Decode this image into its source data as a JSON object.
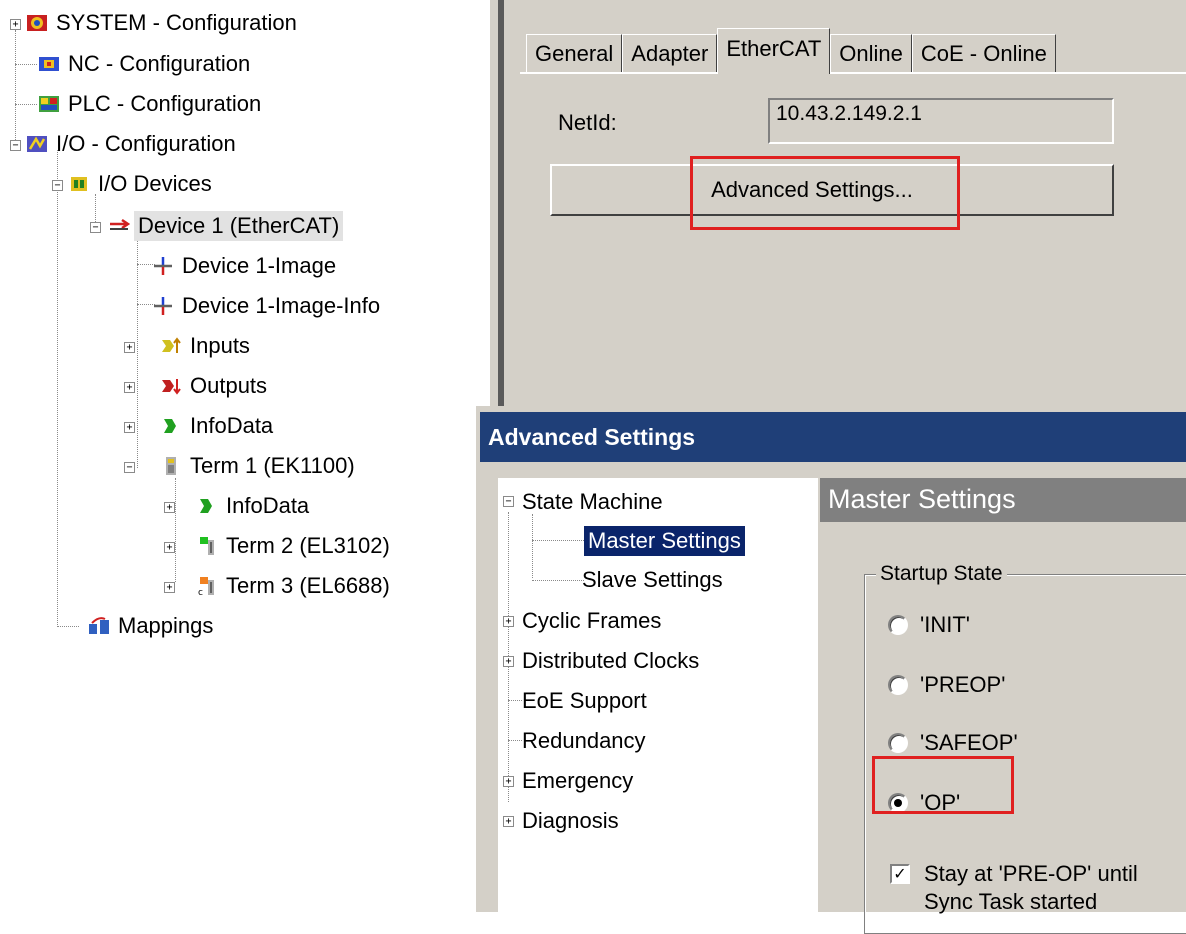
{
  "tree": {
    "items": [
      {
        "label": "SYSTEM - Configuration"
      },
      {
        "label": "NC - Configuration"
      },
      {
        "label": "PLC - Configuration"
      },
      {
        "label": "I/O - Configuration"
      },
      {
        "label": "I/O Devices"
      },
      {
        "label": "Device 1 (EtherCAT)"
      },
      {
        "label": "Device 1-Image"
      },
      {
        "label": "Device 1-Image-Info"
      },
      {
        "label": "Inputs"
      },
      {
        "label": "Outputs"
      },
      {
        "label": "InfoData"
      },
      {
        "label": "Term 1 (EK1100)"
      },
      {
        "label": "InfoData"
      },
      {
        "label": "Term 2 (EL3102)"
      },
      {
        "label": "Term 3 (EL6688)"
      },
      {
        "label": "Mappings"
      }
    ]
  },
  "tabs": [
    "General",
    "Adapter",
    "EtherCAT",
    "Online",
    "CoE - Online"
  ],
  "netid": {
    "label": "NetId:",
    "value": "10.43.2.149.2.1"
  },
  "advanced_button": "Advanced Settings...",
  "dialog": {
    "title": "Advanced Settings",
    "tree": [
      {
        "label": "State Machine"
      },
      {
        "label": "Master Settings"
      },
      {
        "label": "Slave Settings"
      },
      {
        "label": "Cyclic Frames"
      },
      {
        "label": "Distributed Clocks"
      },
      {
        "label": "EoE Support"
      },
      {
        "label": "Redundancy"
      },
      {
        "label": "Emergency"
      },
      {
        "label": "Diagnosis"
      }
    ],
    "panel_title": "Master Settings",
    "startup_state": {
      "legend": "Startup State",
      "options": [
        "'INIT'",
        "'PREOP'",
        "'SAFEOP'",
        "'OP'"
      ],
      "selected": "'OP'"
    },
    "checkbox": {
      "line1": "Stay at 'PRE-OP' until",
      "line2": "Sync Task started",
      "checked": true
    }
  },
  "colors": {
    "highlight": "#e02020",
    "title_bar": "#1f3f78",
    "selection": "#0a246a"
  }
}
